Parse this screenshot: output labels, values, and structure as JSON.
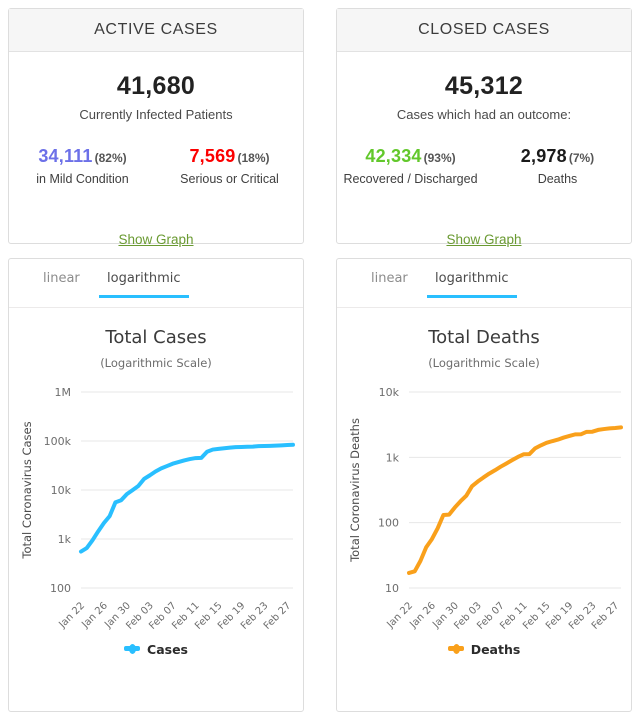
{
  "active_card": {
    "header": "ACTIVE CASES",
    "total": "41,680",
    "caption": "Currently Infected Patients",
    "left": {
      "value": "34,111",
      "percent": "(82%)",
      "label": "in Mild Condition",
      "color": "#6c70e8"
    },
    "right": {
      "value": "7,569",
      "percent": "(18%)",
      "label": "Serious or Critical",
      "color": "#fc0000"
    },
    "show_graph": "Show Graph",
    "link_color": "#6a9a32"
  },
  "closed_card": {
    "header": "CLOSED CASES",
    "total": "45,312",
    "caption": "Cases which had an outcome:",
    "left": {
      "value": "42,334",
      "percent": "(93%)",
      "label": "Recovered / Discharged",
      "color": "#62c82b"
    },
    "right": {
      "value": "2,978",
      "percent": "(7%)",
      "label": "Deaths",
      "color": "#1a1a1a"
    },
    "show_graph": "Show Graph",
    "link_color": "#6a9a32"
  },
  "cases_chart": {
    "tabs": {
      "linear": "linear",
      "logarithmic": "logarithmic",
      "active": "logarithmic"
    },
    "accent_color": "#29bfff",
    "legend_label": "Cases"
  },
  "deaths_chart": {
    "tabs": {
      "linear": "linear",
      "logarithmic": "logarithmic",
      "active": "logarithmic"
    },
    "accent_color": "#29bfff",
    "legend_label": "Deaths"
  },
  "chart_data": [
    {
      "type": "line",
      "id": "total-cases",
      "title": "Total Cases",
      "subtitle": "(Logarithmic Scale)",
      "xlabel": "",
      "ylabel": "Total Coronavirus Cases",
      "yscale": "log",
      "ylim": [
        100,
        1000000
      ],
      "ytick_labels": [
        "100",
        "1k",
        "10k",
        "100k",
        "1M"
      ],
      "ytick_values": [
        100,
        1000,
        10000,
        100000,
        1000000
      ],
      "grid": true,
      "legend": [
        "Cases"
      ],
      "legend_position": "bottom",
      "line_color": "#29bfff",
      "xtick_labels": [
        "Jan 22",
        "Jan 26",
        "Jan 30",
        "Feb 03",
        "Feb 07",
        "Feb 11",
        "Feb 15",
        "Feb 19",
        "Feb 23",
        "Feb 27"
      ],
      "x": [
        "Jan 22",
        "Jan 23",
        "Jan 24",
        "Jan 25",
        "Jan 26",
        "Jan 27",
        "Jan 28",
        "Jan 29",
        "Jan 30",
        "Jan 31",
        "Feb 01",
        "Feb 02",
        "Feb 03",
        "Feb 04",
        "Feb 05",
        "Feb 06",
        "Feb 07",
        "Feb 08",
        "Feb 09",
        "Feb 10",
        "Feb 11",
        "Feb 12",
        "Feb 13",
        "Feb 14",
        "Feb 15",
        "Feb 16",
        "Feb 17",
        "Feb 18",
        "Feb 19",
        "Feb 20",
        "Feb 21",
        "Feb 22",
        "Feb 23",
        "Feb 24",
        "Feb 25",
        "Feb 26",
        "Feb 27",
        "Feb 28"
      ],
      "values": [
        555,
        653,
        941,
        1434,
        2118,
        2927,
        5578,
        6166,
        8234,
        9927,
        12038,
        16787,
        19881,
        23892,
        27635,
        30794,
        34391,
        37120,
        40150,
        42762,
        44802,
        45221,
        60368,
        66885,
        69030,
        71224,
        73258,
        75136,
        75639,
        76197,
        76823,
        78599,
        78985,
        79570,
        80415,
        81397,
        82756,
        83712
      ]
    },
    {
      "type": "line",
      "id": "total-deaths",
      "title": "Total Deaths",
      "subtitle": "(Logarithmic Scale)",
      "xlabel": "",
      "ylabel": "Total Coronavirus Deaths",
      "yscale": "log",
      "ylim": [
        10,
        10000
      ],
      "ytick_labels": [
        "10",
        "100",
        "1k",
        "10k"
      ],
      "ytick_values": [
        10,
        100,
        1000,
        10000
      ],
      "grid": true,
      "legend": [
        "Deaths"
      ],
      "legend_position": "bottom",
      "line_color": "#f9a01b",
      "xtick_labels": [
        "Jan 22",
        "Jan 26",
        "Jan 30",
        "Feb 03",
        "Feb 07",
        "Feb 11",
        "Feb 15",
        "Feb 19",
        "Feb 23",
        "Feb 27"
      ],
      "x": [
        "Jan 22",
        "Jan 23",
        "Jan 24",
        "Jan 25",
        "Jan 26",
        "Jan 27",
        "Jan 28",
        "Jan 29",
        "Jan 30",
        "Jan 31",
        "Feb 01",
        "Feb 02",
        "Feb 03",
        "Feb 04",
        "Feb 05",
        "Feb 06",
        "Feb 07",
        "Feb 08",
        "Feb 09",
        "Feb 10",
        "Feb 11",
        "Feb 12",
        "Feb 13",
        "Feb 14",
        "Feb 15",
        "Feb 16",
        "Feb 17",
        "Feb 18",
        "Feb 19",
        "Feb 20",
        "Feb 21",
        "Feb 22",
        "Feb 23",
        "Feb 24",
        "Feb 25",
        "Feb 26",
        "Feb 27",
        "Feb 28"
      ],
      "values": [
        17,
        18,
        26,
        42,
        56,
        82,
        131,
        133,
        171,
        213,
        259,
        362,
        426,
        492,
        564,
        634,
        719,
        806,
        906,
        1013,
        1113,
        1118,
        1371,
        1523,
        1666,
        1770,
        1868,
        2007,
        2122,
        2247,
        2251,
        2458,
        2469,
        2629,
        2708,
        2770,
        2814,
        2872
      ]
    }
  ]
}
